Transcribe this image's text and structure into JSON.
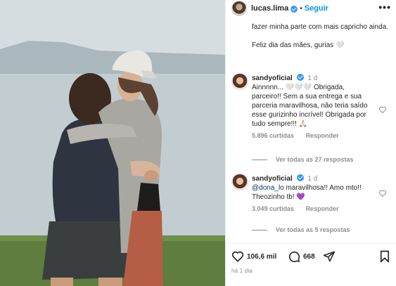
{
  "header": {
    "username": "lucas.lima",
    "separator": "•",
    "follow_label": "Seguir",
    "more_label": "•••"
  },
  "caption": {
    "line1": "fazer minha parte com mais capricho ainda.",
    "line2": "Feliz dia das mães, gurias 🤍"
  },
  "comments": [
    {
      "username": "sandyoficial",
      "time": "1 d",
      "text": "Ainnnnn... 🤍🤍🤍 Obrigada, parceiro!! Sem a sua entrega e sua parceria maravilhosa, não teria saído esse gurizinho incrível! Obrigada por tudo sempre!!! 🙏🏻",
      "likes": "5.896 curtidas",
      "reply_label": "Responder",
      "view_replies": "Ver todas as 27 respostas"
    },
    {
      "username": "sandyoficial",
      "time": "1 d",
      "mention": "@dona_lo",
      "text": " maravilhosa!! Amo mto!! Theozinho tb! 💜",
      "likes": "3.049 curtidas",
      "reply_label": "Responder",
      "view_replies": "Ver todas as 5 respostas"
    }
  ],
  "actions": {
    "likes_count": "106,6 mil",
    "comments_count": "668"
  },
  "time_ago": "há 1 dia",
  "colors": {
    "accent": "#0095f6",
    "verified": "#3897f0",
    "muted": "#8e8e8e",
    "text": "#262626"
  }
}
